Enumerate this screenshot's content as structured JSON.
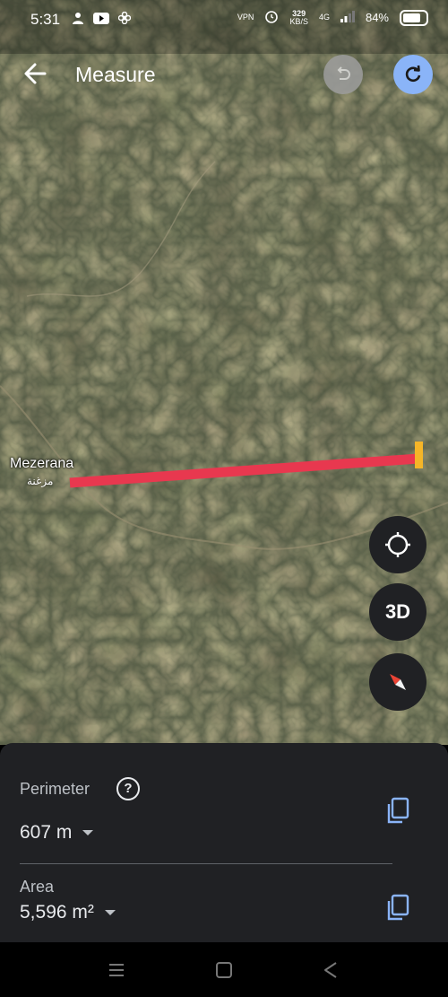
{
  "status": {
    "time": "5:31",
    "net_speed_value": "329",
    "net_speed_unit": "KB/S",
    "network": "4G",
    "battery": "84%",
    "vpn": "VPN"
  },
  "header": {
    "title": "Measure"
  },
  "map": {
    "place_name": "Mezerana",
    "place_name_arabic": "مزغنة",
    "measure_line_color": "#e8384f",
    "endpoint_color": "#f5b528"
  },
  "controls": {
    "three_d_label": "3D"
  },
  "panel": {
    "perimeter_label": "Perimeter",
    "perimeter_value": "607 m",
    "area_label": "Area",
    "area_value": "5,596 m²",
    "help_glyph": "?"
  }
}
